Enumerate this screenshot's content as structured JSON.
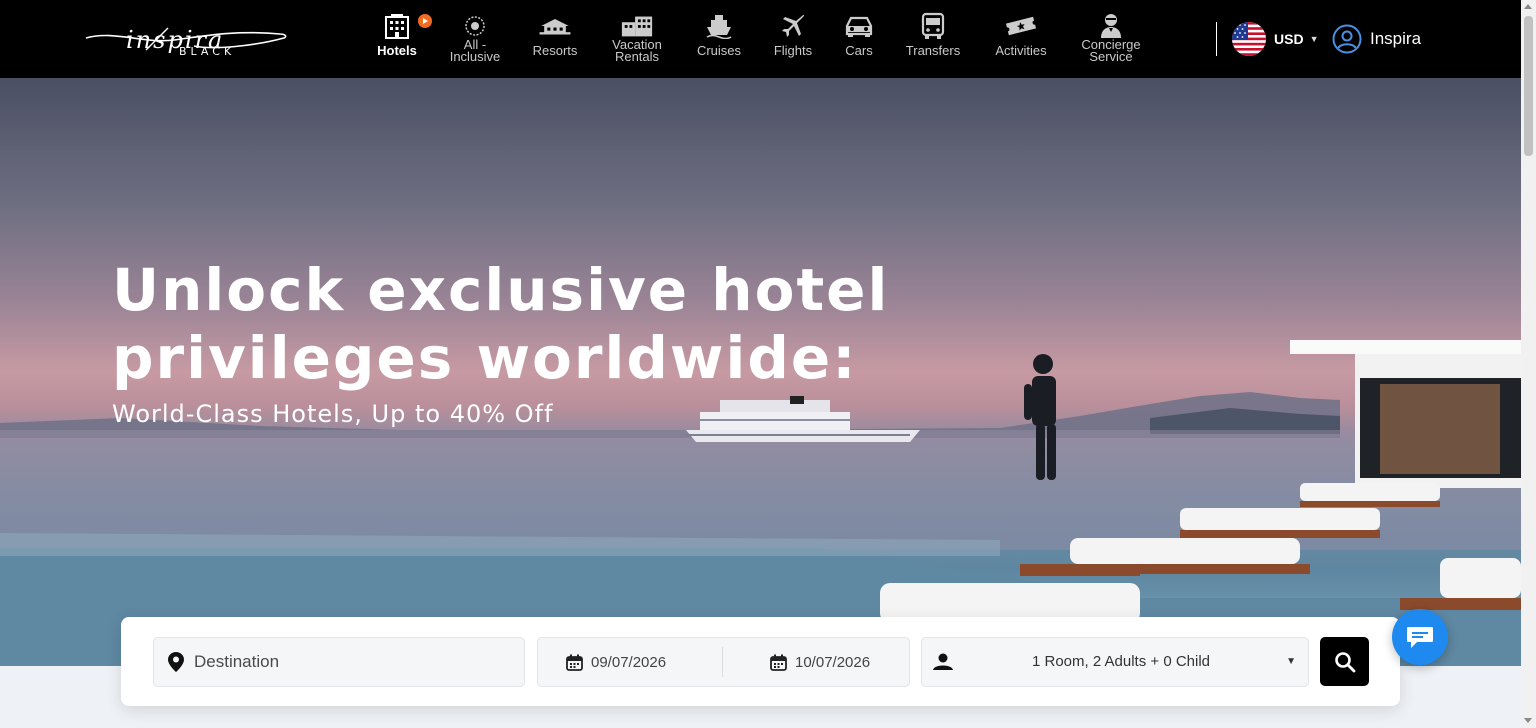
{
  "brand": {
    "name": "inspira",
    "sub": "BLACK"
  },
  "nav": [
    {
      "label": "Hotels",
      "icon": "hotel-icon",
      "active": true,
      "badge": "play-badge-icon"
    },
    {
      "label": "All -",
      "label2": "Inclusive",
      "icon": "all-inclusive-icon"
    },
    {
      "label": "Resorts",
      "icon": "resort-icon"
    },
    {
      "label": "Vacation",
      "label2": "Rentals",
      "icon": "vacation-rental-icon"
    },
    {
      "label": "Cruises",
      "icon": "cruise-ship-icon"
    },
    {
      "label": "Flights",
      "icon": "airplane-icon"
    },
    {
      "label": "Cars",
      "icon": "car-icon"
    },
    {
      "label": "Transfers",
      "icon": "bus-icon"
    },
    {
      "label": "Activities",
      "icon": "ticket-icon"
    },
    {
      "label": "Concierge",
      "label2": "Service",
      "icon": "concierge-icon"
    }
  ],
  "currency": {
    "code": "USD",
    "flag": "us-flag-icon"
  },
  "user": {
    "name": "Inspira"
  },
  "hero": {
    "title": "Unlock exclusive hotel privileges worldwide:",
    "subtitle": "World-Class Hotels, Up to 40% Off"
  },
  "search": {
    "destination_placeholder": "Destination",
    "checkin": "09/07/2026",
    "checkout": "10/07/2026",
    "guests": "1 Room, 2 Adults + 0 Child"
  },
  "colors": {
    "accent": "#f26b21",
    "chat": "#1e8af0",
    "topbar": "#000000"
  }
}
